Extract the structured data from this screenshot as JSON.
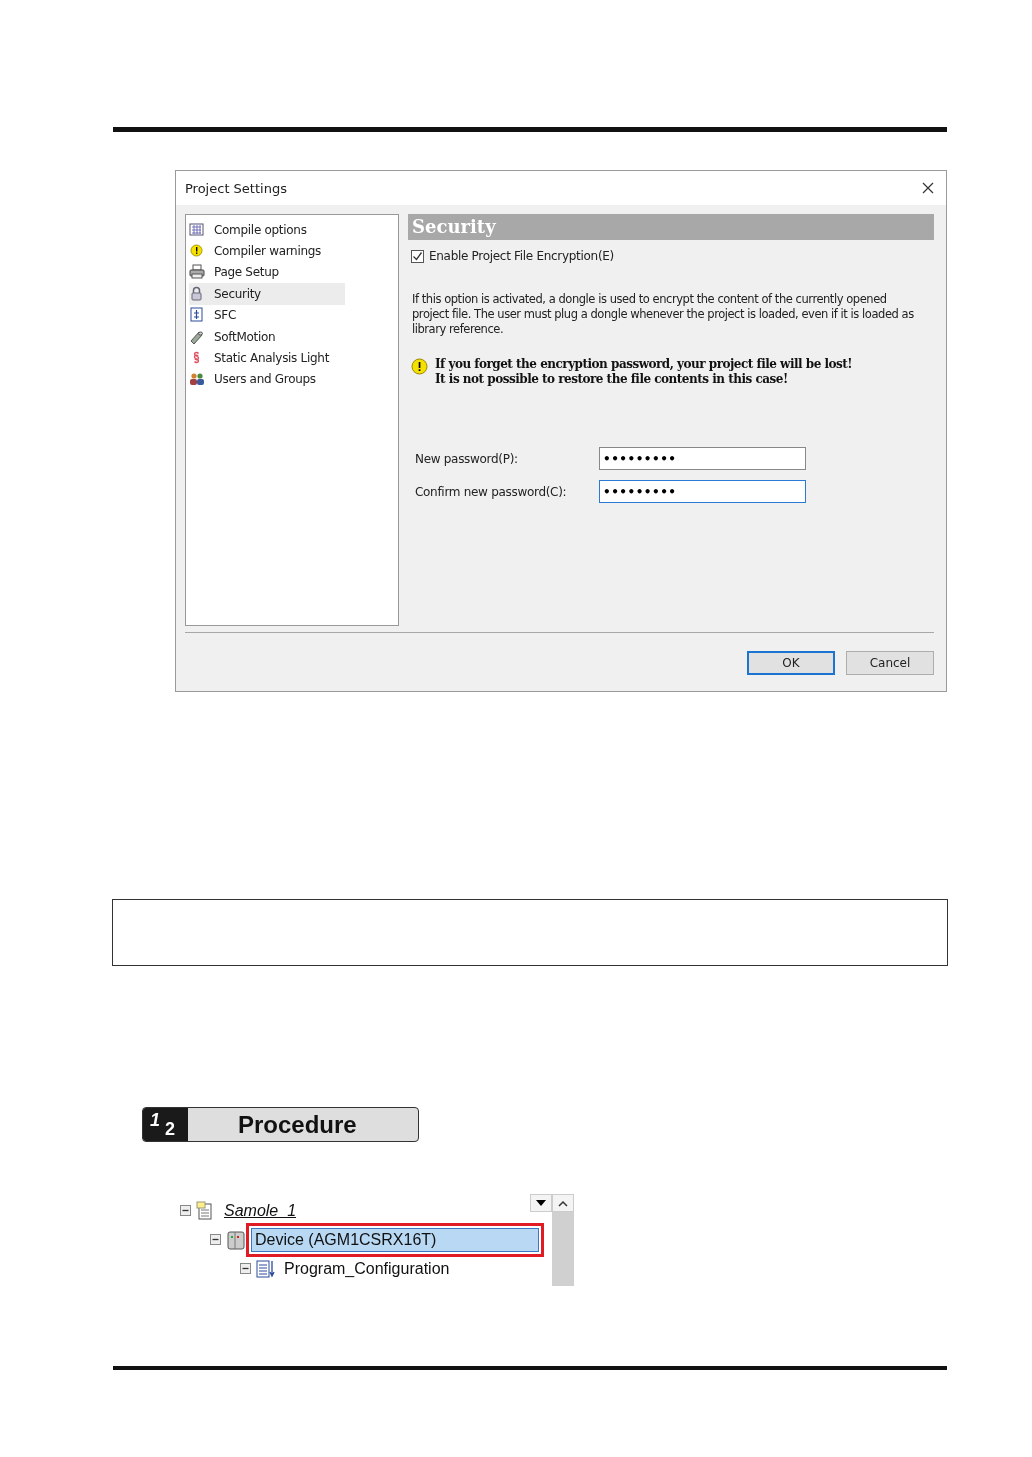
{
  "dialog": {
    "title": "Project Settings",
    "categories": [
      {
        "kind": "compile",
        "label": "Compile options",
        "selected": false
      },
      {
        "kind": "warning",
        "label": "Compiler warnings",
        "selected": false
      },
      {
        "kind": "printer",
        "label": "Page Setup",
        "selected": false
      },
      {
        "kind": "lock",
        "label": "Security",
        "selected": true
      },
      {
        "kind": "chart",
        "label": "SFC",
        "selected": false
      },
      {
        "kind": "motion",
        "label": "SoftMotion",
        "selected": false
      },
      {
        "kind": "section",
        "label": "Static Analysis Light",
        "selected": false
      },
      {
        "kind": "users",
        "label": "Users and Groups",
        "selected": false
      }
    ],
    "panel": {
      "heading": "Security",
      "checkbox": {
        "label": "Enable Project File Encryption(E)",
        "checked": true
      },
      "description": "If this option is activated, a dongle is used to encrypt the content of the currently opened project file. The user must plug a dongle whenever the project is loaded, even if it is loaded as library reference.",
      "warning_lines": [
        "If you forget the encryption password, your project file will be lost!",
        "It is not possible to restore the file contents in this case!"
      ],
      "fields": [
        {
          "label": "New password(P):",
          "value": "•••••••••",
          "focused": false
        },
        {
          "label": "Confirm new password(C):",
          "value": "•••••••••",
          "focused": true
        }
      ]
    },
    "buttons": [
      {
        "label": "OK",
        "default": true
      },
      {
        "label": "Cancel",
        "default": false
      }
    ]
  },
  "procedure": {
    "badge_digits": [
      "1",
      "2"
    ],
    "title": "Procedure"
  },
  "tree": {
    "items": [
      {
        "label": "Samole_1",
        "kind": "project",
        "selected": false,
        "expanded": true,
        "children": [
          {
            "label": "Device (AGM1CSRX16T)",
            "kind": "device",
            "selected": true,
            "expanded": true,
            "children": [
              {
                "label": "Program_Configuration",
                "kind": "config",
                "selected": false,
                "expanded": true
              }
            ]
          }
        ]
      }
    ]
  }
}
